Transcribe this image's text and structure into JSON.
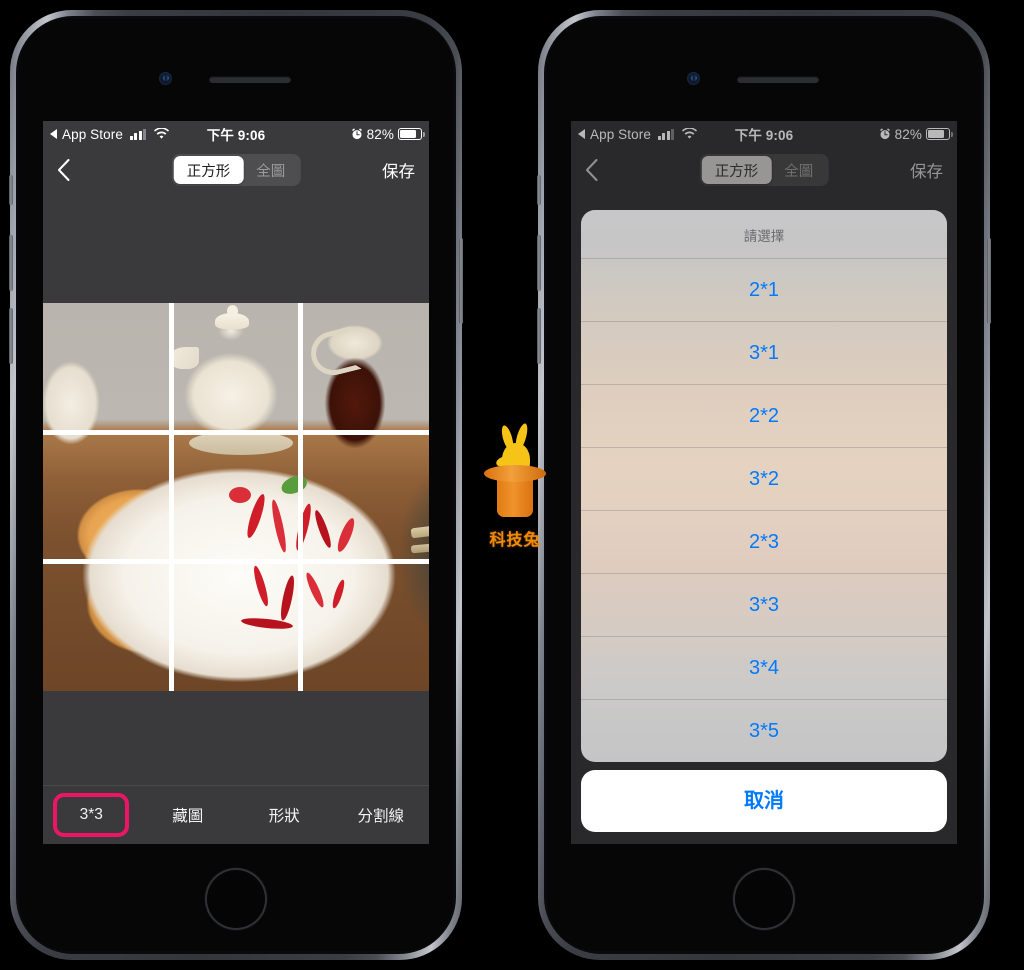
{
  "status_bar": {
    "back_app_label": "App Store",
    "back_arrow_icon": "triangle-left-icon",
    "signal_icon": "cellular-bars-icon",
    "wifi_icon": "wifi-icon",
    "time": "下午 9:06",
    "alarm_icon": "alarm-clock-icon",
    "battery_percent": "82%",
    "battery_icon": "battery-icon"
  },
  "nav_bar": {
    "back_icon": "chevron-left-icon",
    "segments": [
      {
        "label": "正方形",
        "selected": true
      },
      {
        "label": "全圖",
        "selected": false
      }
    ],
    "save_label": "保存"
  },
  "editor": {
    "photo_description": "pancakes-with-whipped-cream-photo",
    "grid_rows": 3,
    "grid_cols": 3,
    "grid_line_color": "#ffffff"
  },
  "toolbar": {
    "items": [
      {
        "label": "3*3",
        "highlighted": true
      },
      {
        "label": "藏圖",
        "highlighted": false
      },
      {
        "label": "形狀",
        "highlighted": false
      },
      {
        "label": "分割線",
        "highlighted": false
      }
    ],
    "highlight_color": "#ec1764"
  },
  "action_sheet": {
    "title": "請選擇",
    "options": [
      "2*1",
      "3*1",
      "2*2",
      "3*2",
      "2*3",
      "3*3",
      "3*4",
      "3*5"
    ],
    "cancel_label": "取消",
    "accent_color": "#007aff"
  },
  "watermark": {
    "brand": "科技兔",
    "logo_icon": "rabbit-in-hat-icon",
    "brand_color": "#f08a0c"
  }
}
